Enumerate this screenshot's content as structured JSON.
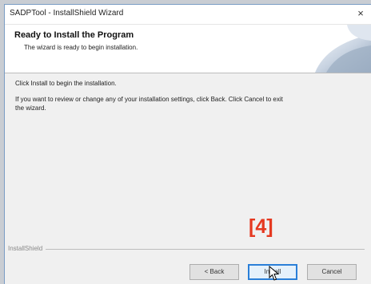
{
  "window": {
    "title": "SADPTool - InstallShield Wizard",
    "close_glyph": "×"
  },
  "header": {
    "title": "Ready to Install the Program",
    "subtitle": "The wizard is ready to begin installation."
  },
  "body": {
    "line1": "Click Install to begin the installation.",
    "line2": "If you want to review or change any of your installation settings, click Back. Click Cancel to exit",
    "line3": "the wizard."
  },
  "footer": {
    "brand": "InstallShield"
  },
  "buttons": {
    "back": "< Back",
    "install": "Install",
    "cancel": "Cancel"
  },
  "annotation": {
    "step_label": "[4]"
  },
  "colors": {
    "annotation": "#e53920",
    "default_button_border": "#2a7fd8"
  },
  "icons": {
    "header": "installshield-swirl-icon",
    "cursor": "mouse-pointer-icon"
  }
}
